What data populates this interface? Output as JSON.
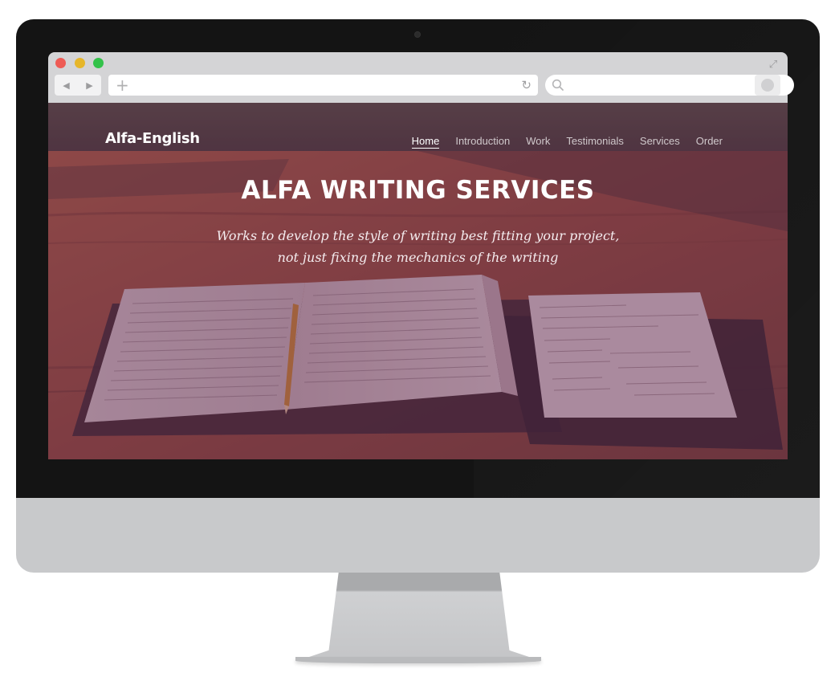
{
  "site": {
    "logo": "Alfa-English",
    "nav": [
      "Home",
      "Introduction",
      "Work",
      "Testimonials",
      "Services",
      "Order"
    ],
    "active_nav": "Home"
  },
  "hero": {
    "title": "ALFA WRITING SERVICES",
    "subtitle": "Works to develop the style of writing best fitting your project, not just fixing the mechanics of the writing"
  },
  "browser": {
    "back_icon": "back-arrow-icon",
    "forward_icon": "forward-arrow-icon",
    "new_tab_icon": "plus-icon",
    "reload_icon": "reload-icon",
    "search_icon": "search-icon",
    "expand_icon": "expand-icon"
  },
  "colors": {
    "overlay": "#693058",
    "bezel": "#141414",
    "chrome": "#d4d4d6",
    "traffic_red": "#ee5b55",
    "traffic_yellow": "#e6b62a",
    "traffic_green": "#33c24a"
  }
}
